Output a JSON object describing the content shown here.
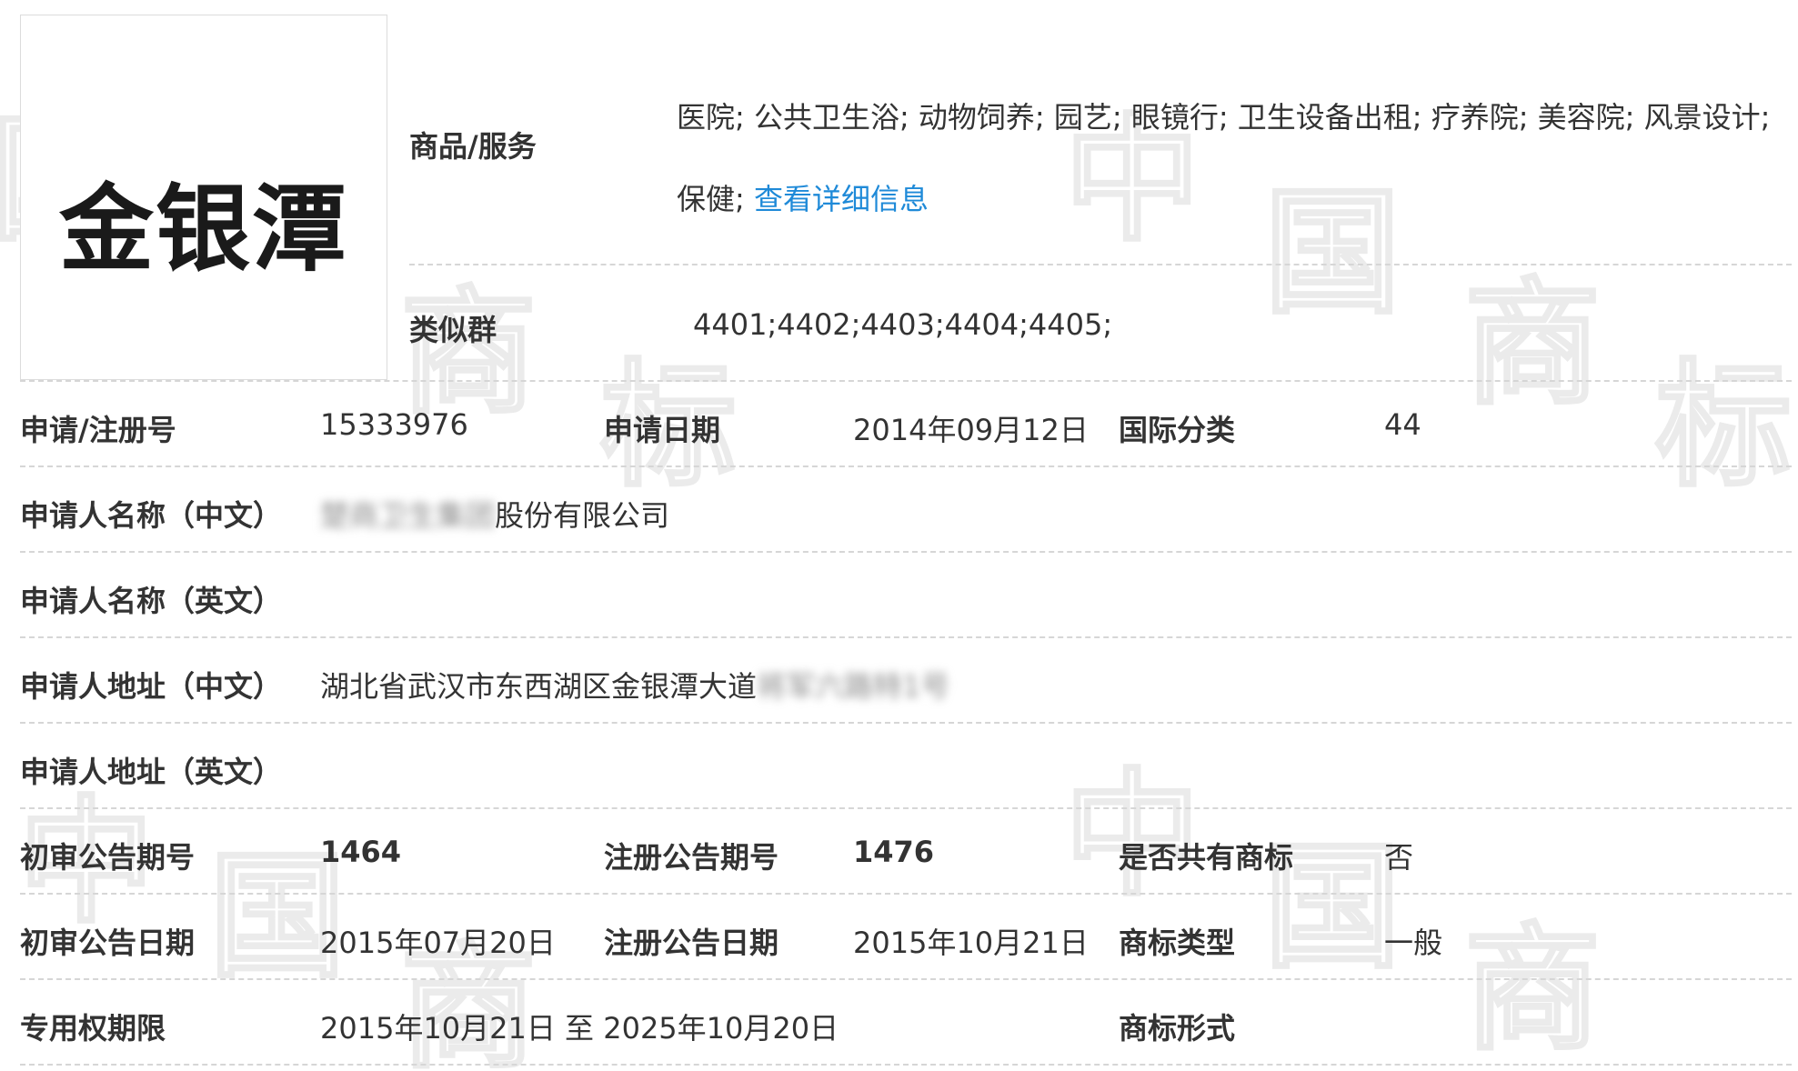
{
  "trademark": {
    "mark_text": "金银潭"
  },
  "goods_services": {
    "label": "商品/服务",
    "items_text": "医院; 公共卫生浴; 动物饲养; 园艺; 眼镜行; 卫生设备出租; 疗养院; 美容院; 风景设计; 保健;",
    "detail_link": "查看详细信息"
  },
  "similar_groups": {
    "label": "类似群",
    "value": "4401;4402;4403;4404;4405;"
  },
  "row_reg": {
    "reg_no_label": "申请/注册号",
    "reg_no": "15333976",
    "app_date_label": "申请日期",
    "app_date": "2014年09月12日",
    "intl_class_label": "国际分类",
    "intl_class": "44"
  },
  "applicant_cn": {
    "label": "申请人名称（中文）",
    "value_hidden": "楚商卫生集团",
    "value_visible": "股份有限公司"
  },
  "applicant_en": {
    "label": "申请人名称（英文）",
    "value": ""
  },
  "address_cn": {
    "label": "申请人地址（中文）",
    "value_visible": "湖北省武汉市东西湖区金银潭大道",
    "value_hidden": "将军六路特1号"
  },
  "address_en": {
    "label": "申请人地址（英文）",
    "value": ""
  },
  "row_announce_no": {
    "prelim_no_label": "初审公告期号",
    "prelim_no": "1464",
    "reg_no_label": "注册公告期号",
    "reg_no": "1476",
    "shared_label": "是否共有商标",
    "shared": "否"
  },
  "row_announce_date": {
    "prelim_date_label": "初审公告日期",
    "prelim_date": "2015年07月20日",
    "reg_date_label": "注册公告日期",
    "reg_date": "2015年10月21日",
    "type_label": "商标类型",
    "type": "一般"
  },
  "row_period": {
    "period_label": "专用权期限",
    "period": "2015年10月21日 至 2025年10月20日",
    "form_label": "商标形式",
    "form": ""
  },
  "colors": {
    "link": "#1f8ad8",
    "text": "#333333",
    "separator": "#d6d6d6"
  }
}
